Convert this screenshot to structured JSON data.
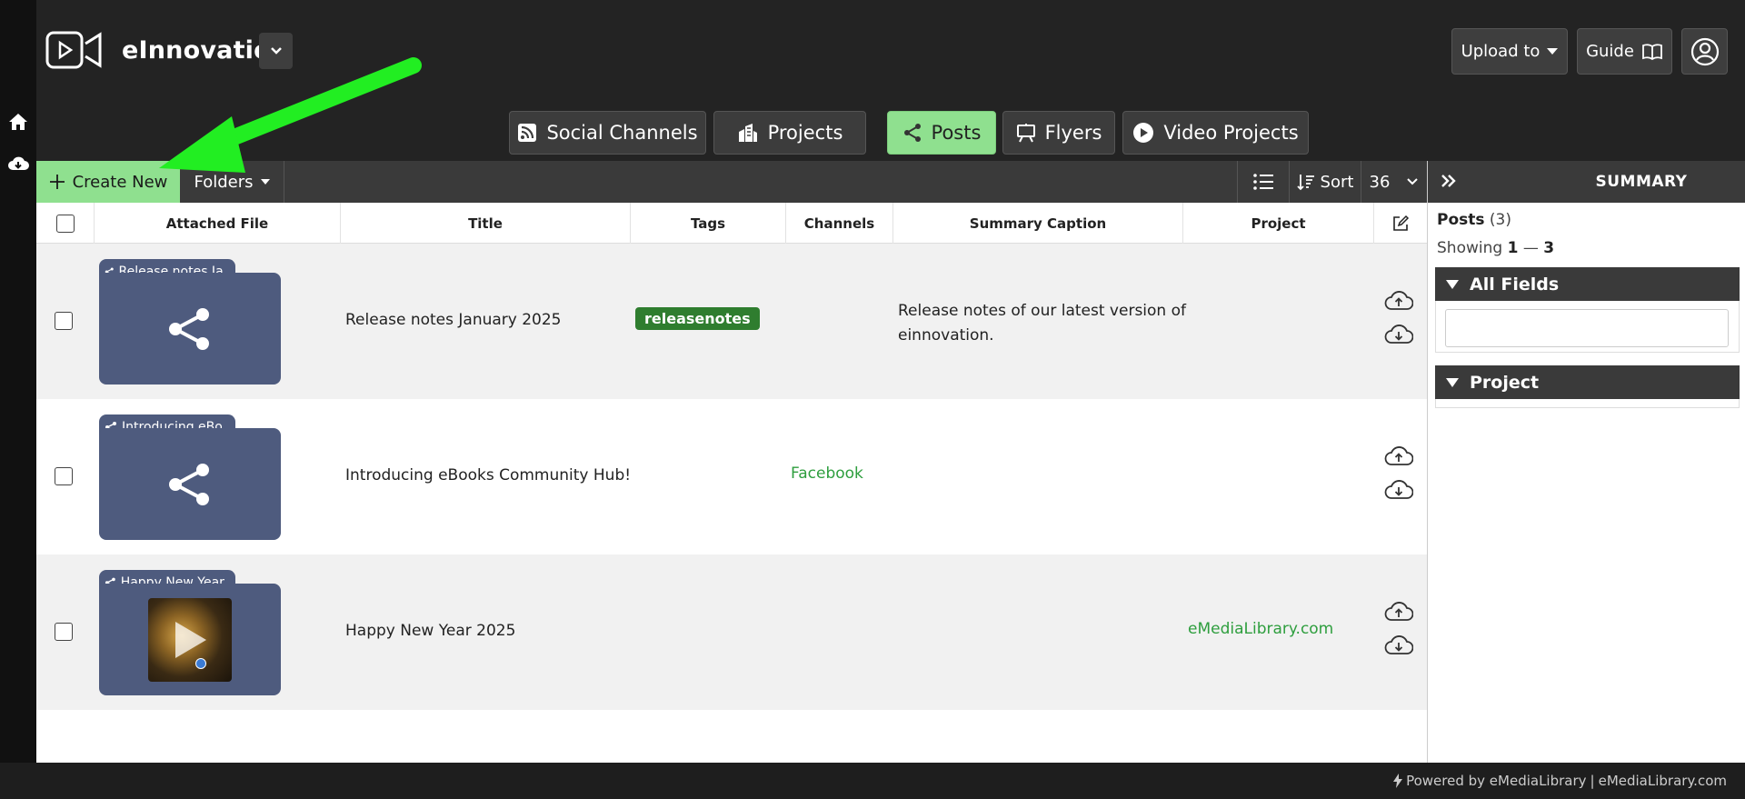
{
  "app": {
    "brand": "eInnovation"
  },
  "header": {
    "upload_label": "Upload to",
    "guide_label": "Guide"
  },
  "tabs": [
    {
      "label": "Social Channels",
      "icon": "rss-icon"
    },
    {
      "label": "Projects",
      "icon": "buildings-icon"
    },
    {
      "label": "Posts",
      "icon": "share-icon",
      "active": true
    },
    {
      "label": "Flyers",
      "icon": "easel-icon"
    },
    {
      "label": "Video Projects",
      "icon": "play-circle-icon"
    }
  ],
  "toolbar": {
    "create_new": "Create New",
    "folders": "Folders",
    "sort": "Sort",
    "page_size": "36"
  },
  "table": {
    "columns": [
      "Attached File",
      "Title",
      "Tags",
      "Channels",
      "Summary Caption",
      "Project"
    ],
    "rows": [
      {
        "file_label": "Release notes Ja...",
        "title": "Release notes January 2025",
        "tag": "releasenotes",
        "channel": "",
        "caption_line1": "Release notes of our latest version of",
        "caption_line2": "einnovation.",
        "project": ""
      },
      {
        "file_label": "Introducing eBo...",
        "title": "Introducing eBooks Community Hub!",
        "tag": "",
        "channel": "Facebook",
        "caption_line1": "",
        "caption_line2": "",
        "project": ""
      },
      {
        "file_label": "Happy New Year...",
        "title": "Happy New Year 2025",
        "tag": "",
        "channel": "",
        "caption_line1": "",
        "caption_line2": "",
        "project": "eMediaLibrary.com"
      }
    ]
  },
  "summary": {
    "title": "SUMMARY",
    "posts_label": "Posts",
    "posts_count": "(3)",
    "showing_label": "Showing",
    "showing_from": "1",
    "showing_dash": "—",
    "showing_to": "3",
    "section_all_fields": "All Fields",
    "section_project": "Project"
  },
  "footer": {
    "powered": "Powered by eMediaLibrary",
    "separator": "|",
    "site": "eMediaLibrary.com"
  },
  "colors": {
    "accent_green": "#8fe08f",
    "tag_green": "#2f7d2f",
    "link_green": "#2e9e3e",
    "folder_blue": "#4e5b7e",
    "annotation_arrow": "#22ee22"
  }
}
